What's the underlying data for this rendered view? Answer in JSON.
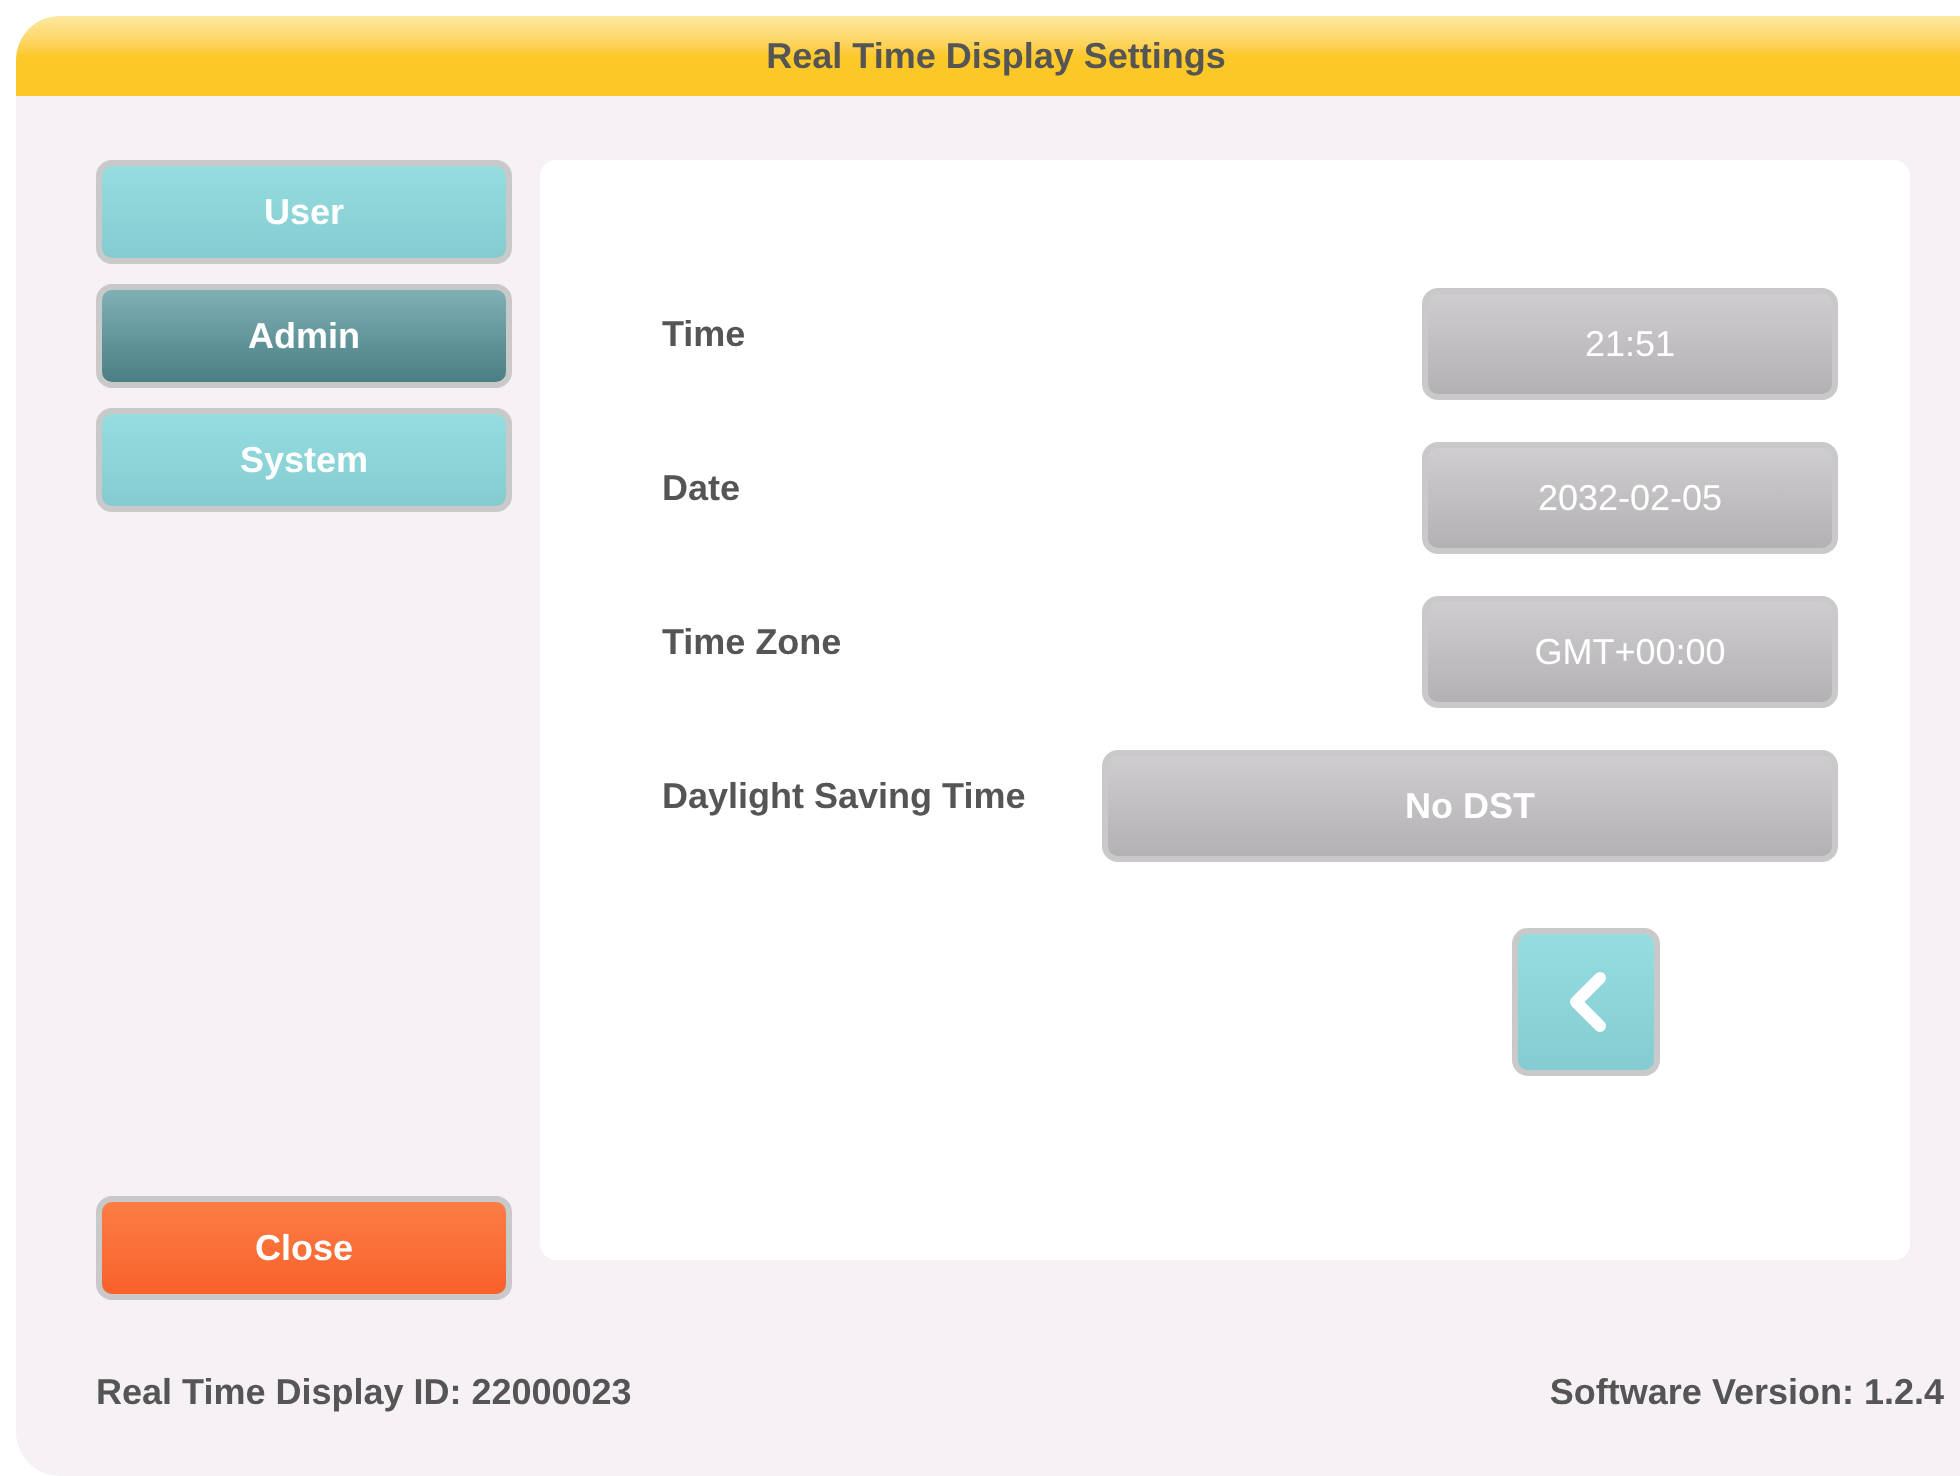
{
  "window": {
    "title": "Real Time Display Settings"
  },
  "nav": [
    {
      "label": "User",
      "selected": false
    },
    {
      "label": "Admin",
      "selected": true
    },
    {
      "label": "System",
      "selected": false
    }
  ],
  "close_button": "Close",
  "settings": [
    {
      "kind": "short",
      "label": "Time",
      "value": "21:51"
    },
    {
      "kind": "short",
      "label": "Date",
      "value": "2032-02-05"
    },
    {
      "kind": "short",
      "label": "Time Zone",
      "value": "GMT+00:00"
    },
    {
      "kind": "wide",
      "label": "Daylight Saving Time",
      "value": "No DST"
    }
  ],
  "status_bar": {
    "display_id": "Real Time Display ID: 22000023",
    "version": "Software Version: 1.2.4"
  }
}
